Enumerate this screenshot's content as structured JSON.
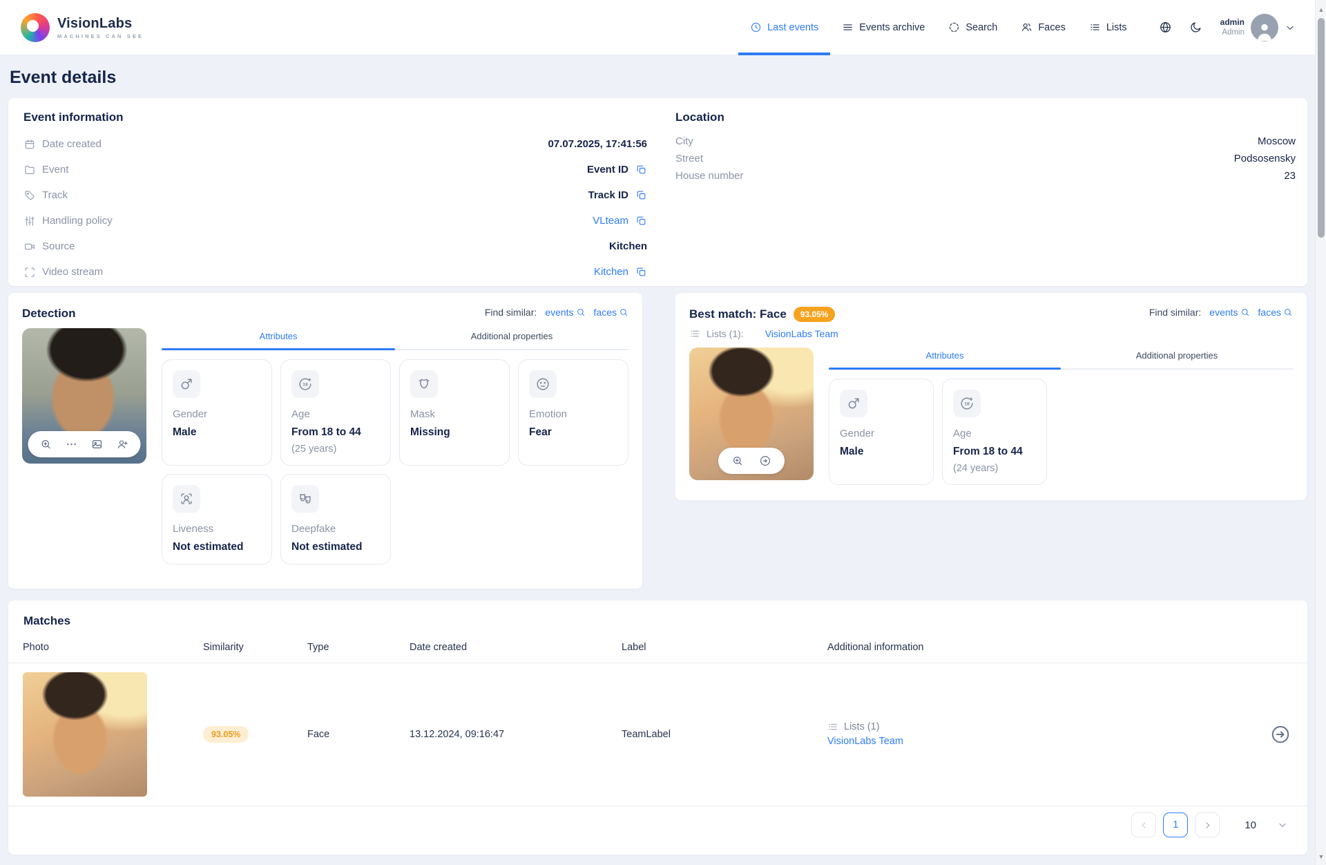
{
  "brand": {
    "name": "VisionLabs",
    "tagline": "MACHINES CAN SEE"
  },
  "nav": {
    "tabs": [
      {
        "label": "Last events"
      },
      {
        "label": "Events archive"
      },
      {
        "label": "Search"
      },
      {
        "label": "Faces"
      },
      {
        "label": "Lists"
      }
    ],
    "user": {
      "name": "admin",
      "role": "Admin"
    }
  },
  "page": {
    "title": "Event details"
  },
  "event_info": {
    "title": "Event information",
    "rows": [
      {
        "label": "Date created",
        "value": "07.07.2025, 17:41:56"
      },
      {
        "label": "Event",
        "value": "Event ID"
      },
      {
        "label": "Track",
        "value": "Track ID"
      },
      {
        "label": "Handling policy",
        "value": "VLteam"
      },
      {
        "label": "Source",
        "value": "Kitchen"
      },
      {
        "label": "Video stream",
        "value": "Kitchen"
      }
    ]
  },
  "location": {
    "title": "Location",
    "rows": [
      {
        "label": "City",
        "value": "Moscow"
      },
      {
        "label": "Street",
        "value": "Podsosensky"
      },
      {
        "label": "House number",
        "value": "23"
      }
    ]
  },
  "detection": {
    "title": "Detection",
    "find_similar": {
      "label": "Find similar:",
      "events": "events",
      "faces": "faces"
    },
    "tabs": {
      "attributes": "Attributes",
      "additional": "Additional properties"
    },
    "attributes": [
      {
        "label": "Gender",
        "value": "Male"
      },
      {
        "label": "Age",
        "value": "From 18 to 44",
        "sub": "(25 years)"
      },
      {
        "label": "Mask",
        "value": "Missing"
      },
      {
        "label": "Emotion",
        "value": "Fear"
      },
      {
        "label": "Liveness",
        "value": "Not estimated"
      },
      {
        "label": "Deepfake",
        "value": "Not estimated"
      }
    ]
  },
  "best_match": {
    "title": "Best match: Face",
    "similarity": "93.05%",
    "lists_label": "Lists (1):",
    "lists_link": "VisionLabs Team",
    "find_similar": {
      "label": "Find similar:",
      "events": "events",
      "faces": "faces"
    },
    "tabs": {
      "attributes": "Attributes",
      "additional": "Additional properties"
    },
    "attributes": [
      {
        "label": "Gender",
        "value": "Male"
      },
      {
        "label": "Age",
        "value": "From 18 to 44",
        "sub": "(24 years)"
      }
    ]
  },
  "matches": {
    "title": "Matches",
    "columns": [
      "Photo",
      "Similarity",
      "Type",
      "Date created",
      "Label",
      "Additional information"
    ],
    "rows": [
      {
        "similarity": "93.05%",
        "type": "Face",
        "date": "13.12.2024, 09:16:47",
        "label": "TeamLabel",
        "lists": "Lists (1)",
        "list_link": "VisionLabs Team"
      }
    ],
    "pagination": {
      "page": "1",
      "page_size": "10"
    }
  },
  "colors": {
    "accent": "#2e7cf6",
    "badge_orange": "#f6a21d",
    "sim_pill_bg": "#fdeed3",
    "sim_pill_text": "#ee9d20"
  }
}
